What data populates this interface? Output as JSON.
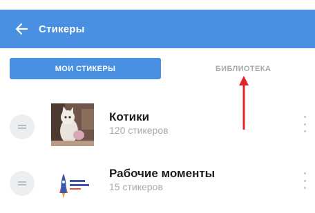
{
  "appbar": {
    "title": "Стикеры",
    "back_icon": "arrow-left-icon",
    "color": "#4a90e2"
  },
  "tabs": [
    {
      "label": "МОИ СТИКЕРЫ",
      "active": true
    },
    {
      "label": "БИБЛИОТЕКА",
      "active": false
    }
  ],
  "annotation": {
    "arrow_color": "#e0242a",
    "points_to": "БИБЛИОТЕКА"
  },
  "sticker_packs": [
    {
      "name": "Котики",
      "count": "120 стикеров",
      "thumb_icon": "cat-photo-thumbnail"
    },
    {
      "name": "Рабочие моменты",
      "count": "15 стикеров",
      "thumb_icon": "rocket-logo-thumbnail"
    }
  ]
}
